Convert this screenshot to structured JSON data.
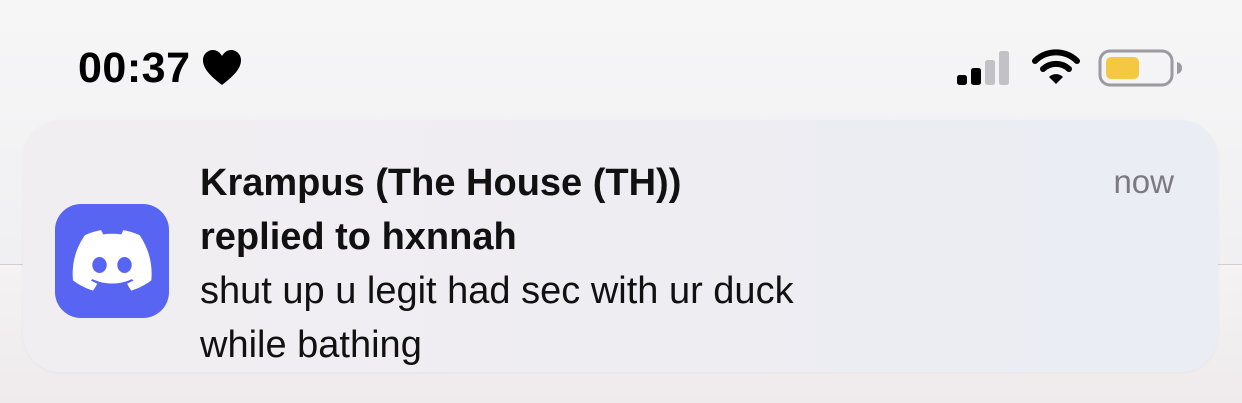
{
  "status_bar": {
    "time": "00:37",
    "focus_icon": "heart-icon",
    "signal_icon": "cellular-signal-icon",
    "wifi_icon": "wifi-icon",
    "battery_icon": "battery-icon",
    "battery_fill_color": "#f5c842",
    "cellular_bars_total": 4,
    "cellular_bars_active": 2
  },
  "notification": {
    "app_icon": "discord-icon",
    "app_icon_color": "#5865f2",
    "title": "Krampus (The House (TH))",
    "subtitle": "replied to hxnnah",
    "body_lines": [
      "shut up u legit had sec with ur duck",
      "while bathing"
    ],
    "time": "now"
  }
}
